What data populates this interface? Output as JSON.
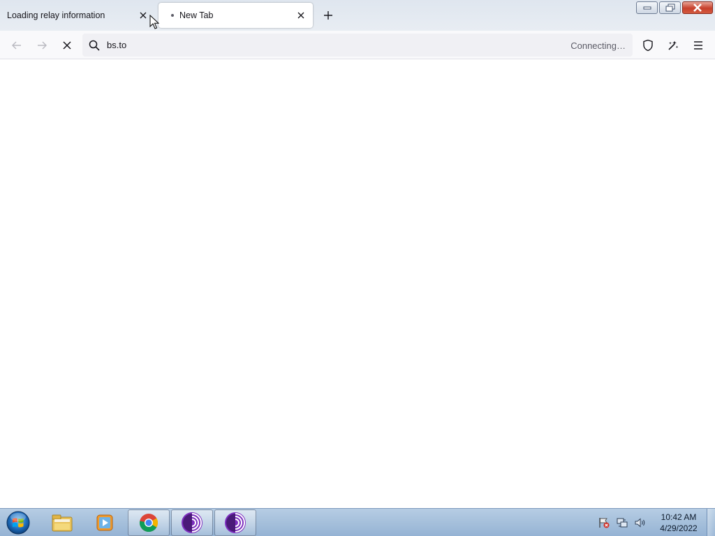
{
  "browser": {
    "tabs": [
      {
        "title": "Loading relay information",
        "active": false
      },
      {
        "title": "New Tab",
        "active": true,
        "loading_indicator": true
      }
    ],
    "new_tab_icon": "plus-icon",
    "close_tab_icon": "close-icon"
  },
  "navbar": {
    "back_icon": "back-arrow-icon",
    "forward_icon": "forward-arrow-icon",
    "stop_icon": "stop-icon",
    "url": "bs.to",
    "status": "Connecting…",
    "right_icons": [
      "shield-icon",
      "security-level-icon",
      "menu-icon"
    ]
  },
  "taskbar": {
    "pinned": [
      "start-orb",
      "file-explorer-icon",
      "media-player-icon",
      "chrome-icon",
      "tor-browser-icon",
      "tor-browser-icon"
    ],
    "clock": {
      "time": "10:42 AM",
      "date": "4/29/2022"
    }
  },
  "colors": {
    "tor_purple": "#7d2fbf",
    "taskbar_blue": "#a7c1dc",
    "close_red": "#c7402c"
  }
}
